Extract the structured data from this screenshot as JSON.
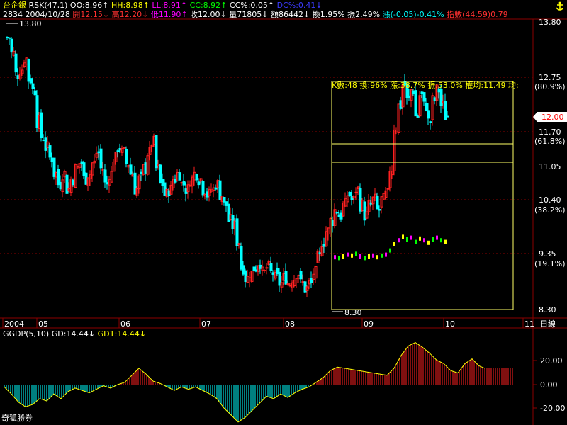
{
  "header": {
    "line1": [
      {
        "text": "台企銀",
        "color": "#ffff00"
      },
      {
        "text": "RSK(47,1)",
        "color": "#ffffff"
      },
      {
        "text": "OO:8.96↑",
        "color": "#ffffff"
      },
      {
        "text": "HH:8.98↑",
        "color": "#ffff00"
      },
      {
        "text": "LL:8.91↑",
        "color": "#ff00ff"
      },
      {
        "text": "CC:8.92↑",
        "color": "#00ff00"
      },
      {
        "text": "CC%:0.05↑",
        "color": "#ffffff"
      },
      {
        "text": "DC%:0.41↓",
        "color": "#3b3bff"
      }
    ],
    "line2": [
      {
        "text": "2834 2004/10/28",
        "color": "#ffffff"
      },
      {
        "text": "開12.15↓",
        "color": "#ff3030"
      },
      {
        "text": "高12.20↓",
        "color": "#ff3030"
      },
      {
        "text": "低11.90↑",
        "color": "#ff00ff"
      },
      {
        "text": "收12.00↓",
        "color": "#ffffff"
      },
      {
        "text": "量71805↓",
        "color": "#ffffff"
      },
      {
        "text": "額86442↓",
        "color": "#ffffff"
      },
      {
        "text": "換1.95%",
        "color": "#ffffff"
      },
      {
        "text": "振2.49%",
        "color": "#ffffff"
      },
      {
        "text": "漲(-0.05)-0.41%",
        "color": "#00ffff"
      },
      {
        "text": "指數(44.59)0.79",
        "color": "#ff3030"
      }
    ],
    "anchor_icon": "anchor-icon"
  },
  "price_axis": {
    "labels": [
      "13.80",
      "12.75",
      "(80.9%)",
      "11.70",
      "(61.8%)",
      "11.05",
      "10.40",
      "(38.2%)",
      "9.35",
      "(19.1%)",
      "8.30"
    ],
    "current": "12.00"
  },
  "markers": {
    "high": "13.80",
    "low": "8.30"
  },
  "time_axis": {
    "labels": [
      "2004",
      "05",
      "06",
      "07",
      "08",
      "09",
      "10",
      "11"
    ],
    "unit": "日線"
  },
  "box": {
    "info": "K數:48 換:96% 漲:38.7% 振:53.0% 權均:11.49 均:"
  },
  "indicator": {
    "labels": [
      {
        "text": "GGDP(5,10)",
        "color": "#ffffff"
      },
      {
        "text": "GD:14.44↓",
        "color": "#ffffff"
      },
      {
        "text": "GD1:14.44↓",
        "color": "#ffff00"
      }
    ],
    "axis": [
      "20.00",
      "0.00",
      "-20.00"
    ]
  },
  "brand": "奇狐勝券",
  "colors": {
    "up": "#ff2020",
    "down": "#00ffff",
    "grid": "#8b0000",
    "frame": "#8b0000",
    "box": "#ffff66"
  },
  "chart_data": [
    {
      "type": "candlestick",
      "title": "台企銀 2834 日線",
      "ylim": [
        8.3,
        13.8
      ],
      "yticks": [
        13.8,
        12.75,
        11.7,
        11.05,
        10.4,
        9.35,
        8.3
      ],
      "x_labels": [
        "2004",
        "05",
        "06",
        "07",
        "08",
        "09",
        "10",
        "11"
      ],
      "last": {
        "open": 12.15,
        "high": 12.2,
        "low": 11.9,
        "close": 12.0,
        "volume": 71805
      },
      "key_levels": {
        "high": 13.8,
        "low": 8.3
      },
      "close_points": [
        [
          0,
          13.5
        ],
        [
          6,
          13.2
        ],
        [
          12,
          12.8
        ],
        [
          18,
          12.9
        ],
        [
          24,
          13.1
        ],
        [
          30,
          12.7
        ],
        [
          36,
          12.5
        ],
        [
          42,
          11.9
        ],
        [
          48,
          11.6
        ],
        [
          54,
          11.4
        ],
        [
          60,
          11.2
        ],
        [
          66,
          10.9
        ],
        [
          72,
          10.7
        ],
        [
          78,
          10.9
        ],
        [
          84,
          10.6
        ],
        [
          90,
          10.8
        ],
        [
          96,
          11.0
        ],
        [
          102,
          11.1
        ],
        [
          108,
          10.8
        ],
        [
          114,
          10.9
        ],
        [
          120,
          11.1
        ],
        [
          126,
          11.3
        ],
        [
          132,
          11.0
        ],
        [
          138,
          10.7
        ],
        [
          144,
          10.9
        ],
        [
          150,
          11.2
        ],
        [
          156,
          11.4
        ],
        [
          162,
          11.3
        ],
        [
          168,
          11.1
        ],
        [
          174,
          10.9
        ],
        [
          180,
          10.6
        ],
        [
          186,
          10.8
        ],
        [
          192,
          11.0
        ],
        [
          198,
          11.3
        ],
        [
          204,
          11.5
        ],
        [
          210,
          11.0
        ],
        [
          216,
          10.7
        ],
        [
          222,
          10.5
        ],
        [
          228,
          10.6
        ],
        [
          234,
          10.8
        ],
        [
          240,
          10.9
        ],
        [
          246,
          10.7
        ],
        [
          252,
          10.6
        ],
        [
          258,
          10.8
        ],
        [
          264,
          10.9
        ],
        [
          270,
          10.8
        ],
        [
          276,
          10.6
        ],
        [
          282,
          10.5
        ],
        [
          288,
          10.6
        ],
        [
          294,
          10.7
        ],
        [
          300,
          10.5
        ],
        [
          306,
          10.3
        ],
        [
          312,
          10.0
        ],
        [
          318,
          9.9
        ],
        [
          324,
          9.6
        ],
        [
          330,
          9.1
        ],
        [
          336,
          8.9
        ],
        [
          342,
          9.0
        ],
        [
          348,
          9.1
        ],
        [
          354,
          9.2
        ],
        [
          360,
          9.0
        ],
        [
          366,
          9.1
        ],
        [
          372,
          9.0
        ],
        [
          378,
          8.9
        ],
        [
          384,
          8.8
        ],
        [
          390,
          8.9
        ],
        [
          396,
          8.8
        ],
        [
          402,
          8.9
        ],
        [
          408,
          9.0
        ],
        [
          414,
          8.8
        ],
        [
          420,
          8.7
        ],
        [
          426,
          8.8
        ],
        [
          432,
          9.0
        ],
        [
          438,
          9.3
        ],
        [
          444,
          9.6
        ],
        [
          450,
          9.8
        ],
        [
          456,
          10.0
        ],
        [
          462,
          10.2
        ],
        [
          468,
          10.1
        ],
        [
          474,
          10.3
        ],
        [
          480,
          10.5
        ],
        [
          486,
          10.4
        ],
        [
          492,
          10.6
        ],
        [
          498,
          10.3
        ],
        [
          504,
          10.1
        ],
        [
          510,
          10.3
        ],
        [
          516,
          10.4
        ],
        [
          522,
          10.2
        ],
        [
          528,
          10.4
        ],
        [
          534,
          10.5
        ],
        [
          540,
          11.0
        ],
        [
          546,
          11.8
        ],
        [
          552,
          12.2
        ],
        [
          558,
          12.6
        ],
        [
          564,
          12.3
        ],
        [
          570,
          12.5
        ],
        [
          576,
          12.0
        ],
        [
          582,
          12.4
        ],
        [
          588,
          12.2
        ],
        [
          594,
          11.9
        ],
        [
          600,
          12.3
        ],
        [
          606,
          12.5
        ],
        [
          612,
          12.2
        ],
        [
          618,
          12.0
        ]
      ]
    },
    {
      "type": "bar",
      "title": "GGDP(5,10)",
      "ylim": [
        -30,
        45
      ],
      "yticks": [
        20.0,
        0.0,
        -20.0
      ],
      "series_labels": [
        "GD",
        "GD1"
      ],
      "last_values": {
        "GD": 14.44,
        "GD1": 14.44
      },
      "points": [
        [
          0,
          -2
        ],
        [
          10,
          -8
        ],
        [
          20,
          -15
        ],
        [
          30,
          -19
        ],
        [
          40,
          -17
        ],
        [
          50,
          -12
        ],
        [
          60,
          -14
        ],
        [
          70,
          -8
        ],
        [
          80,
          -12
        ],
        [
          90,
          -6
        ],
        [
          100,
          -3
        ],
        [
          110,
          -5
        ],
        [
          120,
          -7
        ],
        [
          130,
          -4
        ],
        [
          140,
          -1
        ],
        [
          150,
          -3
        ],
        [
          160,
          0
        ],
        [
          170,
          2
        ],
        [
          180,
          8
        ],
        [
          190,
          14
        ],
        [
          200,
          9
        ],
        [
          210,
          3
        ],
        [
          220,
          1
        ],
        [
          230,
          -2
        ],
        [
          240,
          -5
        ],
        [
          250,
          -2
        ],
        [
          260,
          -4
        ],
        [
          270,
          -2
        ],
        [
          280,
          -5
        ],
        [
          290,
          -8
        ],
        [
          300,
          -12
        ],
        [
          310,
          -20
        ],
        [
          320,
          -26
        ],
        [
          330,
          -32
        ],
        [
          340,
          -28
        ],
        [
          350,
          -22
        ],
        [
          360,
          -16
        ],
        [
          370,
          -10
        ],
        [
          380,
          -12
        ],
        [
          390,
          -8
        ],
        [
          400,
          -11
        ],
        [
          410,
          -7
        ],
        [
          420,
          -4
        ],
        [
          430,
          -2
        ],
        [
          440,
          2
        ],
        [
          450,
          6
        ],
        [
          460,
          12
        ],
        [
          470,
          15
        ],
        [
          480,
          14
        ],
        [
          490,
          13
        ],
        [
          500,
          12
        ],
        [
          510,
          11
        ],
        [
          520,
          10
        ],
        [
          530,
          9
        ],
        [
          540,
          8
        ],
        [
          550,
          14
        ],
        [
          560,
          25
        ],
        [
          570,
          33
        ],
        [
          580,
          36
        ],
        [
          590,
          32
        ],
        [
          600,
          27
        ],
        [
          610,
          21
        ],
        [
          620,
          18
        ],
        [
          630,
          12
        ],
        [
          640,
          10
        ],
        [
          650,
          18
        ],
        [
          660,
          22
        ],
        [
          670,
          16
        ],
        [
          678,
          14
        ]
      ]
    }
  ]
}
